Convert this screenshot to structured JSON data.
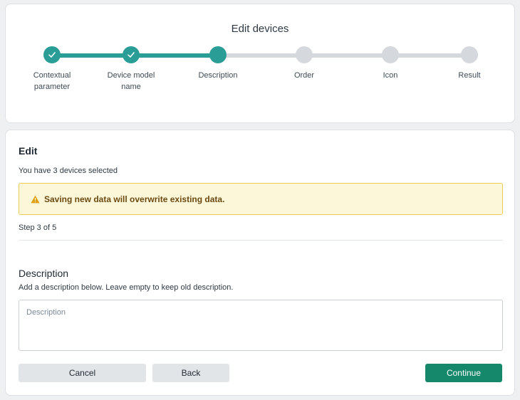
{
  "stepper": {
    "title": "Edit devices",
    "steps": [
      {
        "label": "Contextual parameter",
        "state": "done"
      },
      {
        "label": "Device model name",
        "state": "done"
      },
      {
        "label": "Description",
        "state": "current"
      },
      {
        "label": "Order",
        "state": "todo"
      },
      {
        "label": "Icon",
        "state": "todo"
      },
      {
        "label": "Result",
        "state": "todo"
      }
    ]
  },
  "edit": {
    "heading": "Edit",
    "selected_text": "You have 3 devices selected",
    "warning": {
      "icon": "warning-triangle-icon",
      "text": "Saving new data will overwrite existing data."
    },
    "step_counter": "Step 3 of 5",
    "description": {
      "heading": "Description",
      "help": "Add a description below. Leave empty to keep old description.",
      "placeholder": "Description",
      "value": ""
    },
    "buttons": {
      "cancel": "Cancel",
      "back": "Back",
      "continue": "Continue"
    }
  },
  "colors": {
    "accent": "#2a9d96",
    "primary_button": "#15876a",
    "warning_bg": "#fdf7d9",
    "warning_border": "#e8cc53",
    "inactive_step": "#d5d8dc"
  }
}
